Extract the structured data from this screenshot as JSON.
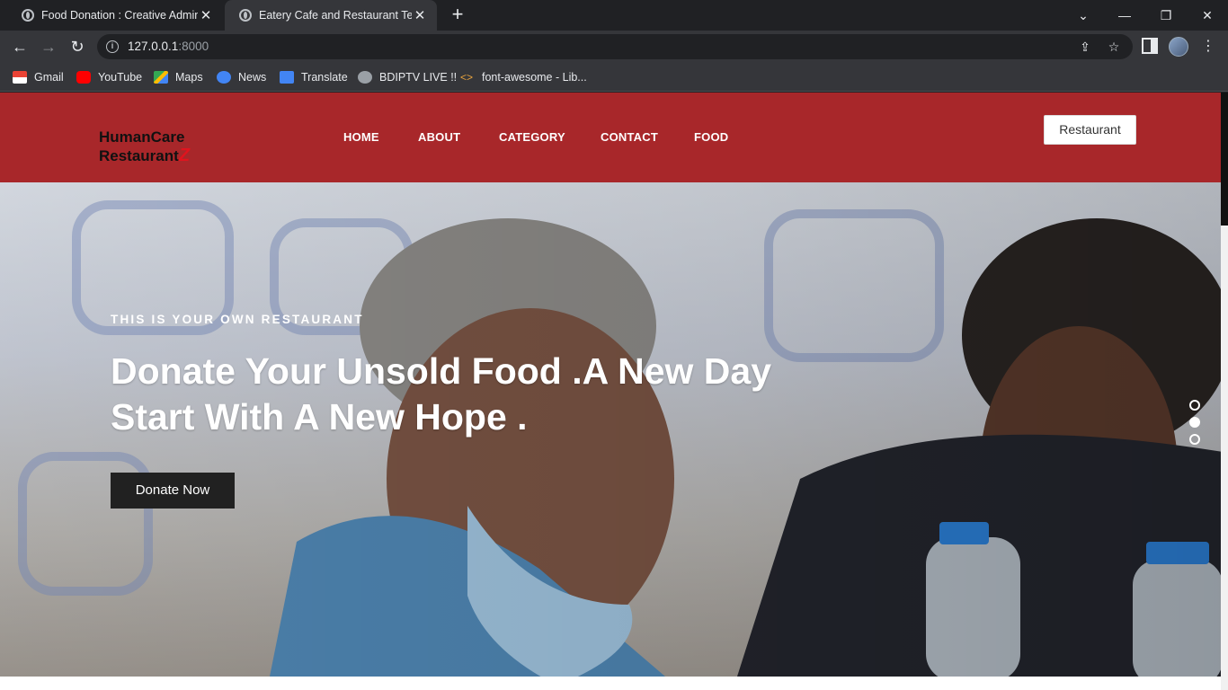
{
  "browser": {
    "tabs": [
      {
        "title": "Food Donation : Creative Admin I"
      },
      {
        "title": "Eatery Cafe and Restaurant Temp"
      }
    ],
    "url_host": "127.0.0.1",
    "url_port": ":8000",
    "bookmarks": [
      {
        "label": "Gmail",
        "icon": "gmail-icon",
        "color": "#ea4335"
      },
      {
        "label": "YouTube",
        "icon": "youtube-icon",
        "color": "#ff0000"
      },
      {
        "label": "Maps",
        "icon": "maps-icon",
        "color": "#34a853"
      },
      {
        "label": "News",
        "icon": "news-icon",
        "color": "#4285f4"
      },
      {
        "label": "Translate",
        "icon": "translate-icon",
        "color": "#4285f4"
      },
      {
        "label": "BDIPTV LIVE !!",
        "icon": "globe-icon",
        "color": "#9aa0a6"
      },
      {
        "label": "font-awesome - Lib...",
        "icon": "code-icon",
        "color": "#e8a33d"
      }
    ]
  },
  "site": {
    "brand_color": "#a8272a",
    "logo_line1": "HumanCare",
    "logo_line2": "Restaurant",
    "logo_mark": "Z",
    "nav": [
      "HOME",
      "ABOUT",
      "CATEGORY",
      "CONTACT",
      "FOOD"
    ],
    "header_button": "Restaurant",
    "hero": {
      "eyebrow": "THIS IS YOUR OWN RESTAURANT",
      "headline": "Donate Your Unsold Food .A New Day Start With A New Hope .",
      "cta": "Donate Now",
      "slides": 3,
      "active_slide": 2
    }
  }
}
